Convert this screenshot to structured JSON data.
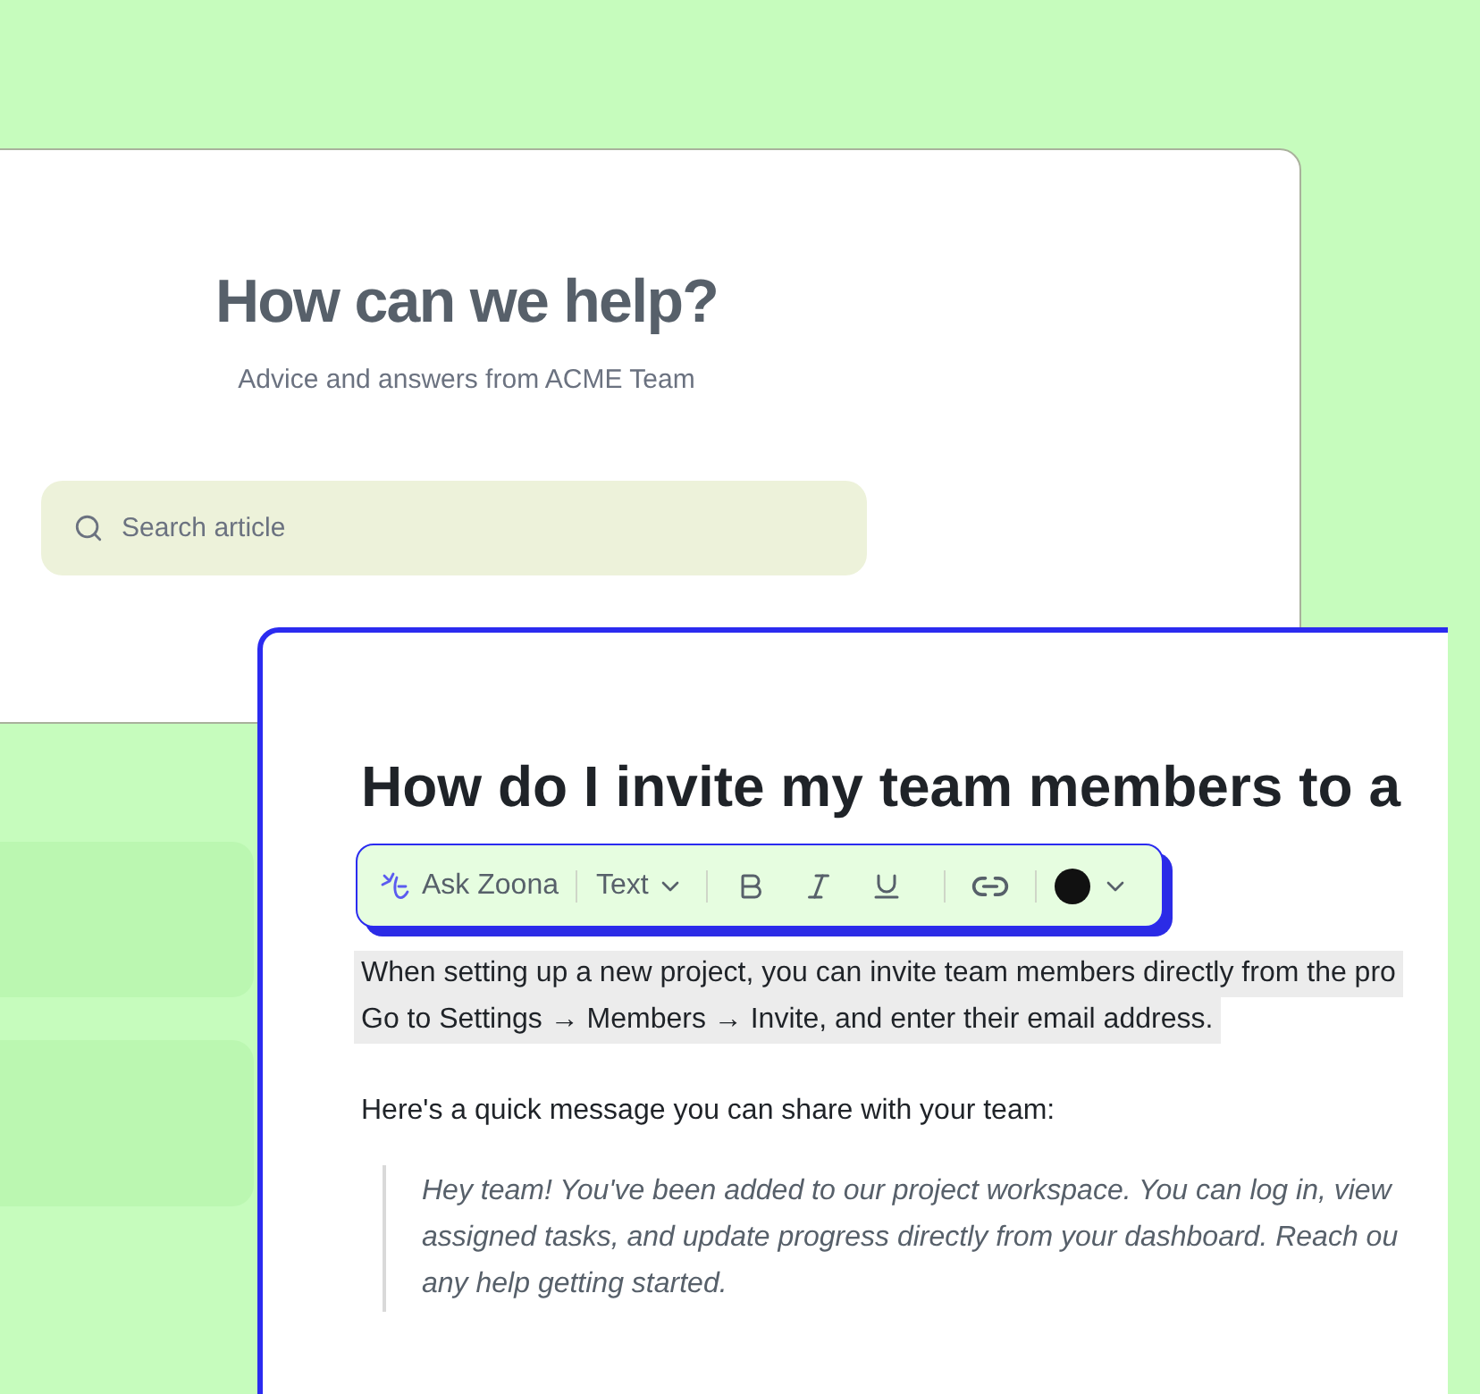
{
  "help_card": {
    "title": "How can we help?",
    "subtitle": "Advice and answers from ACME Team",
    "search": {
      "placeholder": "Search article"
    }
  },
  "article": {
    "title": "How do I invite my team members to a",
    "paragraph": {
      "selected": true,
      "lines": [
        "When setting up a new project, you can invite team members directly from the pro",
        "Go to Settings → Members → Invite, and enter their email address."
      ]
    },
    "intro": "Here's a quick message you can share with your team:",
    "quote_lines": [
      "Hey team! You've been added to our project workspace. You can log in, view",
      "assigned tasks, and update progress directly from your dashboard. Reach ou",
      "any help getting started."
    ]
  },
  "toolbar": {
    "ask_label": "Ask Zoona",
    "style_label": "Text"
  }
}
